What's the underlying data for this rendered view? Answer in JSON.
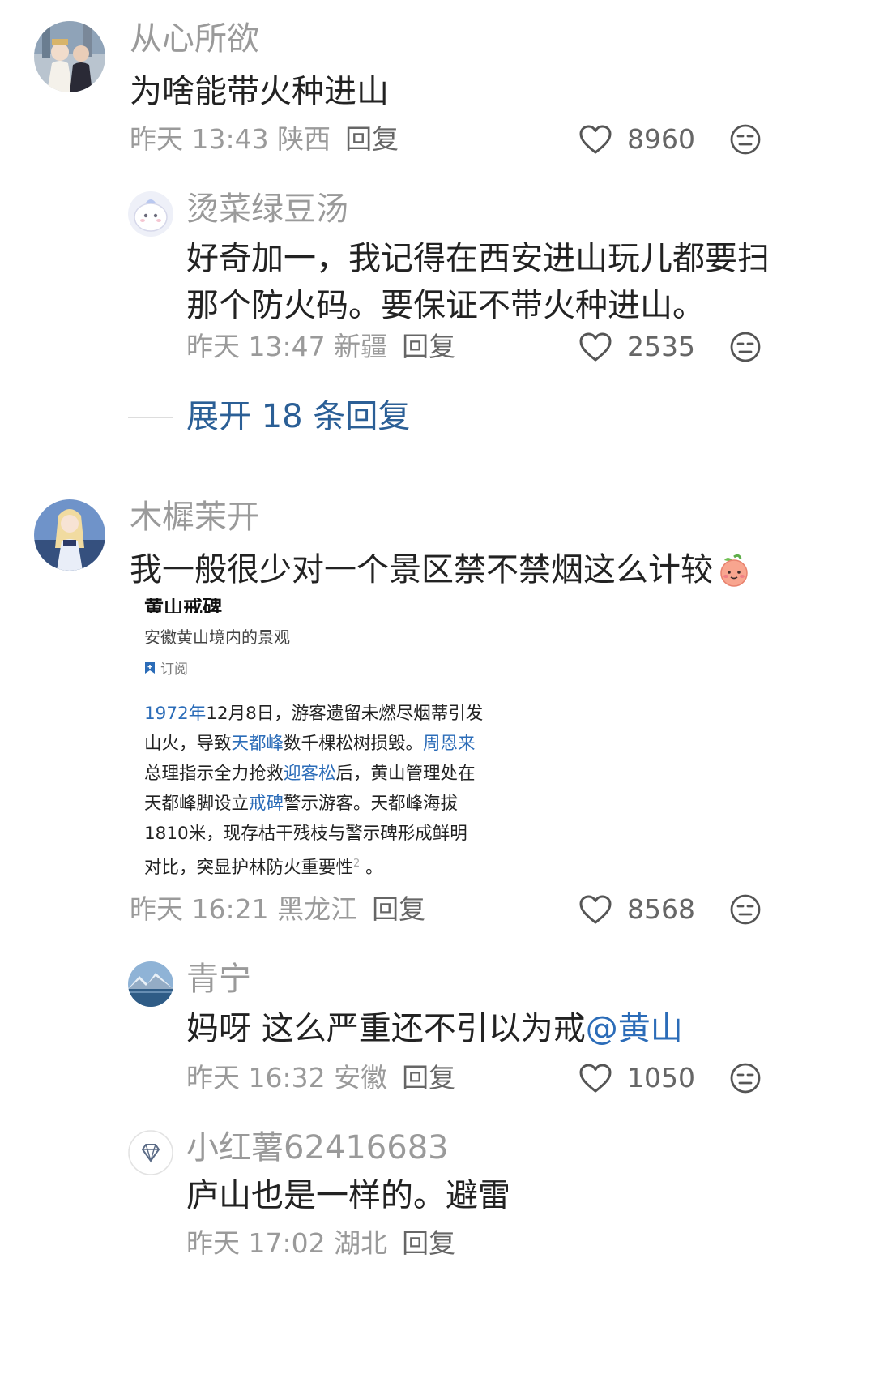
{
  "comments": [
    {
      "name": "从心所欲",
      "text": "为啥能带火种进山",
      "meta": "昨天 13:43 陕西",
      "reply": "回复",
      "likes": "8960"
    },
    {
      "name": "烫菜绿豆汤",
      "text": "好奇加一，我记得在西安进山玩儿都要扫那个防火码。要保证不带火种进山。",
      "meta": "昨天 13:47 新疆",
      "reply": "回复",
      "likes": "2535"
    },
    {
      "name": "木樨茉开",
      "text": "我一般很少对一个景区禁不禁烟这么计较",
      "meta": "昨天 16:21 黑龙江",
      "reply": "回复",
      "likes": "8568"
    },
    {
      "name": "青宁",
      "text": "妈呀 这么严重还不引以为戒",
      "mention": "@黄山",
      "meta": "昨天 16:32 安徽",
      "reply": "回复",
      "likes": "1050"
    },
    {
      "name": "小红薯62416683",
      "text": "庐山也是一样的。避雷",
      "meta": "昨天 17:02 湖北",
      "reply": "回复"
    }
  ],
  "expand_label": "展开 18 条回复",
  "quote": {
    "title": "黄山戒碑",
    "subtitle": "安徽黄山境内的景观",
    "subscribe": "订阅",
    "seg1_link": "1972年",
    "seg1": "12月8日，游客遗留未燃尽烟蒂引发山火，导致",
    "seg2_link": "天都峰",
    "seg2": "数千棵松树损毁。",
    "seg3_link": "周恩来",
    "seg3": "总理指示全力抢救",
    "seg4_link": "迎客松",
    "seg4": "后，黄山管理处在天都峰脚设立",
    "seg5_link": "戒碑",
    "seg5": "警示游客。天都峰海拔1810米，现存枯干残枝与警示碑形成鲜明对比，突显护林防火重要性",
    "sup": "2",
    "end": "。"
  },
  "icons": {
    "like": "heart-outline-icon",
    "emoji": "neutral-face-icon",
    "sticker": "peach-face-emoji",
    "subscribe": "bookmark-icon",
    "avatar5": "diamond-icon"
  },
  "colors": {
    "link": "#2b6cb8",
    "expand": "#2b5f96",
    "name": "#9a9a9a"
  }
}
